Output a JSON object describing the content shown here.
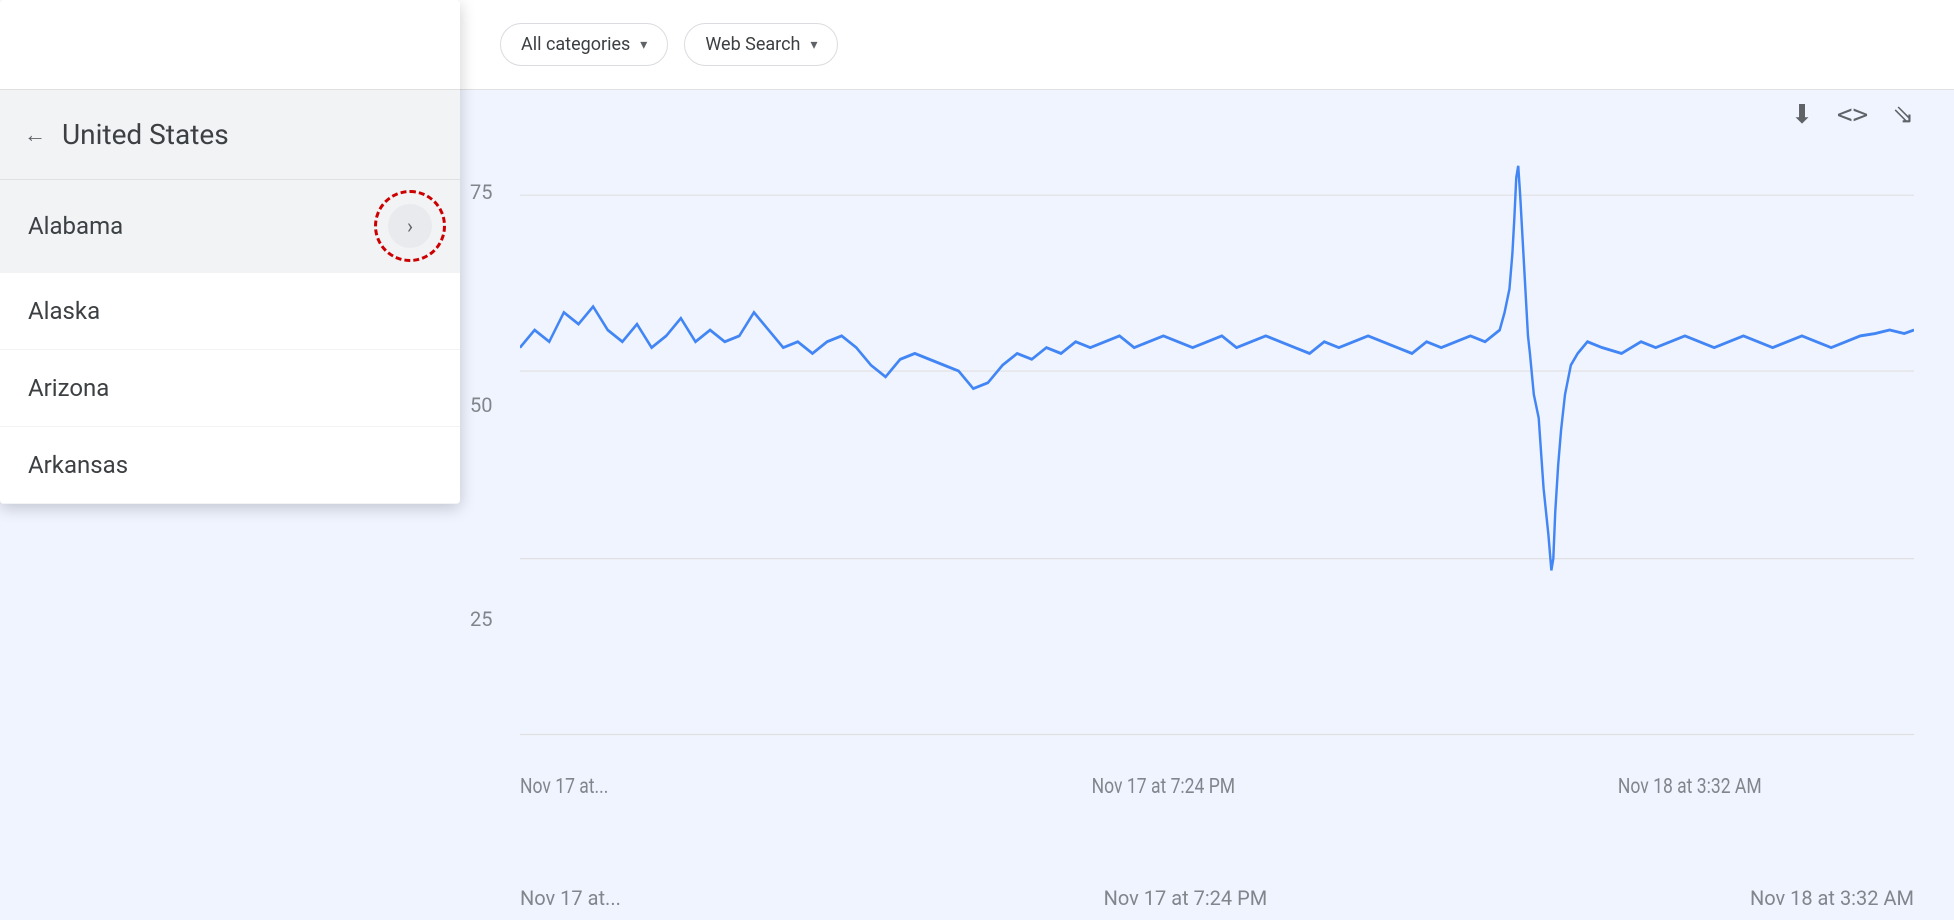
{
  "toolbar": {
    "categories_label": "All categories",
    "search_type_label": "Web Search",
    "chevron": "▾"
  },
  "dropdown": {
    "header": {
      "back_icon": "←",
      "title": "United States"
    },
    "items": [
      {
        "label": "Alabama",
        "has_chevron": true
      },
      {
        "label": "Alaska",
        "has_chevron": false
      },
      {
        "label": "Arizona",
        "has_chevron": false
      },
      {
        "label": "Arkansas",
        "has_chevron": false
      }
    ]
  },
  "chart": {
    "y_labels": [
      "75",
      "50",
      "25"
    ],
    "x_labels": [
      "Nov 17 at...",
      "Nov 17 at 7:24 PM",
      "Nov 18 at 3:32 AM"
    ],
    "icons": {
      "download": "⬇",
      "embed": "<>",
      "share": "⎘"
    }
  }
}
